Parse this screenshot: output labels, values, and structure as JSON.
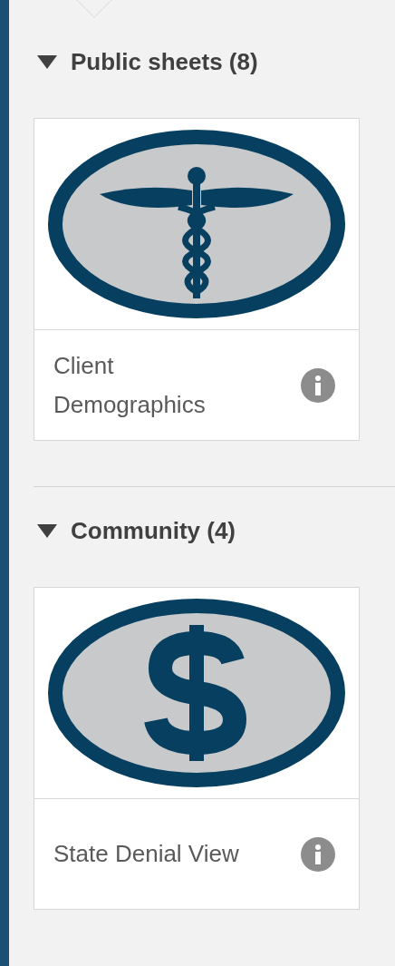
{
  "sections": [
    {
      "title": "Public sheets (8)",
      "expanded": true,
      "sheets": [
        {
          "title": "Client Demographics",
          "kind": "caduceus"
        }
      ]
    },
    {
      "title": "Community (4)",
      "expanded": true,
      "sheets": [
        {
          "title": "State Denial View",
          "kind": "dollar"
        }
      ]
    }
  ]
}
